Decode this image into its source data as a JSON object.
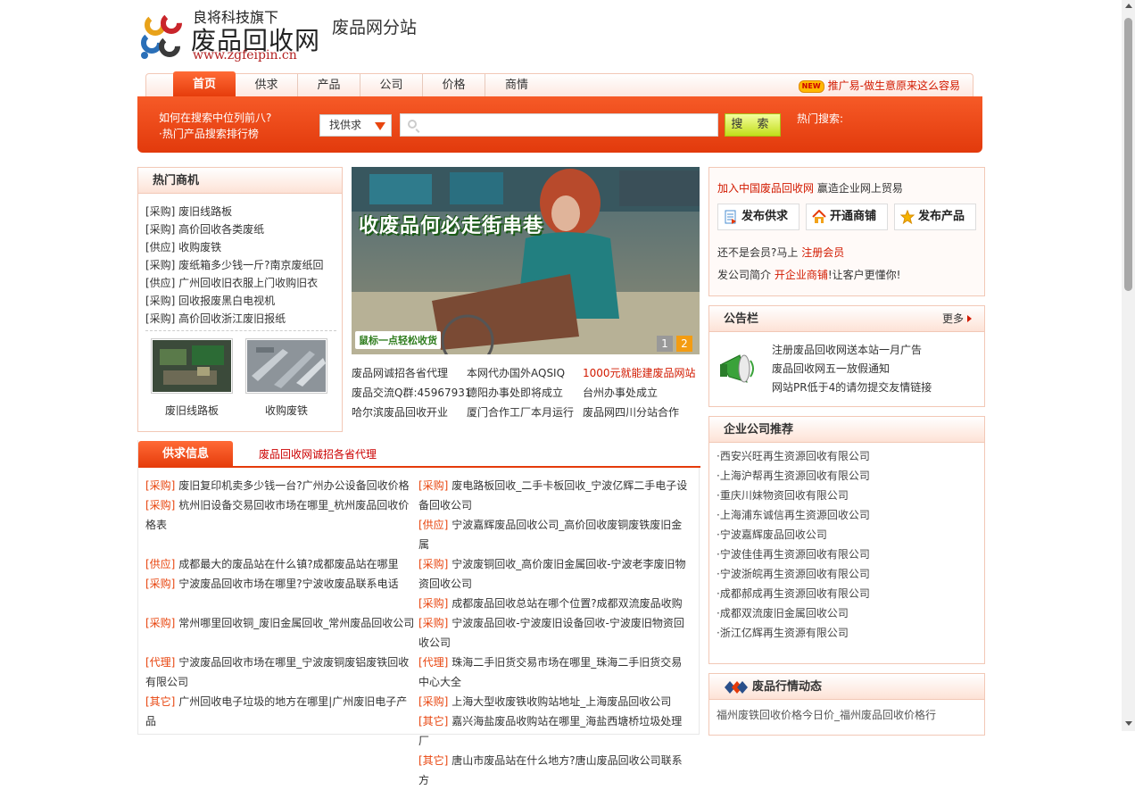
{
  "logo": {
    "subtitle": "良将科技旗下",
    "title": "废品回收网",
    "url": "www.zgfeipin.cn",
    "site": "废品网分站"
  },
  "nav": {
    "items": [
      "首页",
      "供求",
      "产品",
      "公司",
      "价格",
      "商情"
    ],
    "active_index": 0,
    "promo_badge": "NEW",
    "promo": "推广易-做生意原来这么容易"
  },
  "search": {
    "link1": "如何在搜索中位列前八?",
    "link2": "·热门产品搜索排行榜",
    "select_value": "找供求",
    "placeholder": "",
    "button": "搜 索",
    "hot_label": "热门搜索:"
  },
  "hot": {
    "title": "热门商机",
    "items": [
      "[采购] 废旧线路板",
      "[采购] 高价回收各类废纸",
      "[供应] 收购废铁",
      "[采购] 废纸箱多少钱一斤?南京废纸回",
      "[供应] 广州回收旧衣服上门收购旧衣",
      "[采购] 回收报废黑白电视机",
      "[采购] 高价回收浙江废旧报纸"
    ],
    "thumbs": [
      "废旧线路板",
      "收购废铁"
    ]
  },
  "slider": {
    "caption": "收废品何必走街串巷",
    "tag": "鼠标一点轻松收货",
    "pages": [
      "1",
      "2"
    ],
    "active_page": 1
  },
  "news": [
    [
      "废品网诚招各省代理",
      "本网代办国外AQSIQ",
      "1000元就能建废品网站"
    ],
    [
      "废品交流Q群:45967931",
      "德阳办事处即将成立",
      "台州办事处成立"
    ],
    [
      "哈尔滨废品回收开业",
      "厦门合作工厂本月运行",
      "废品网四川分站合作"
    ]
  ],
  "supply": {
    "tab": "供求信息",
    "link": "废品回收网诚招各省代理",
    "left": [
      {
        "tag": "[采购]",
        "text": "废旧复印机卖多少钱一台?广州办公设备回收价格"
      },
      {
        "tag": "[采购]",
        "text": "杭州旧设备交易回收市场在哪里_杭州废品回收价格表"
      },
      {
        "tag": "[供应]",
        "text": "成都最大的废品站在什么镇?成都废品站在哪里"
      },
      {
        "tag": "[采购]",
        "text": "宁波废品回收市场在哪里?宁波收废品联系电话"
      },
      {
        "tag": "[采购]",
        "text": "常州哪里回收铜_废旧金属回收_常州废品回收公司"
      },
      {
        "tag": "[代理]",
        "text": "宁波废品回收市场在哪里_宁波废铜废铝废铁回收有限公司"
      },
      {
        "tag": "[其它]",
        "text": "广州回收电子垃圾的地方在哪里|广州废旧电子产品"
      }
    ],
    "right": [
      {
        "tag": "[采购]",
        "text": "废电路板回收_二手卡板回收_宁波亿辉二手电子设备回收公司"
      },
      {
        "tag": "[供应]",
        "text": "宁波嘉辉废品回收公司_高价回收废铜废铁废旧金属"
      },
      {
        "tag": "[采购]",
        "text": "宁波废铜回收_高价废旧金属回收-宁波老李废旧物资回收公司"
      },
      {
        "tag": "[采购]",
        "text": "成都废品回收总站在哪个位置?成都双流废品收购"
      },
      {
        "tag": "[采购]",
        "text": "宁波废品回收-宁波废旧设备回收-宁波废旧物资回收公司"
      },
      {
        "tag": "[代理]",
        "text": "珠海二手旧货交易市场在哪里_珠海二手旧货交易中心大全"
      },
      {
        "tag": "[采购]",
        "text": "上海大型收废铁收购站地址_上海废品回收公司"
      },
      {
        "tag": "[其它]",
        "text": "嘉兴海盐废品收购站在哪里_海盐西塘桥垃圾处理厂"
      },
      {
        "tag": "[其它]",
        "text": "唐山市废品站在什么地方?唐山废品回收公司联系方"
      }
    ]
  },
  "join": {
    "link": "加入中国废品回收网",
    "text": "赢造企业网上贸易",
    "buttons": [
      "发布供求",
      "开通商铺",
      "发布产品"
    ],
    "line1_pre": "还不是会员?马上",
    "line1_link": "注册会员",
    "line2_pre": "发公司简介",
    "line2_link": "开企业商铺",
    "line2_post": "!让客户更懂你!"
  },
  "notice": {
    "title": "公告栏",
    "more": "更多",
    "items": [
      "注册废品回收网送本站一月广告",
      "废品回收网五一放假通知",
      "网站PR低于4的请勿提交友情链接"
    ]
  },
  "companies": {
    "title": "企业公司推荐",
    "items": [
      "·西安兴旺再生资源回收有限公司",
      "·上海沪帮再生资源回收有限公司",
      "·重庆川妹物资回收有限公司",
      "·上海浦东诚信再生资源回收公司",
      "·宁波嘉辉废品回收公司",
      "·宁波佳佳再生资源回收有限公司",
      "·宁波浙皖再生资源回收有限公司",
      "·成都郝成再生资源回收有限公司",
      "·成都双流废旧金属回收公司",
      "·浙江亿辉再生资源有限公司"
    ]
  },
  "market": {
    "title": "废品行情动态",
    "items": [
      "福州废铁回收价格今日价_福州废品回收价格行"
    ]
  },
  "colors": {
    "accent": "#e53b0a",
    "link_red": "#d21a00",
    "border": "#f2c8b6"
  }
}
